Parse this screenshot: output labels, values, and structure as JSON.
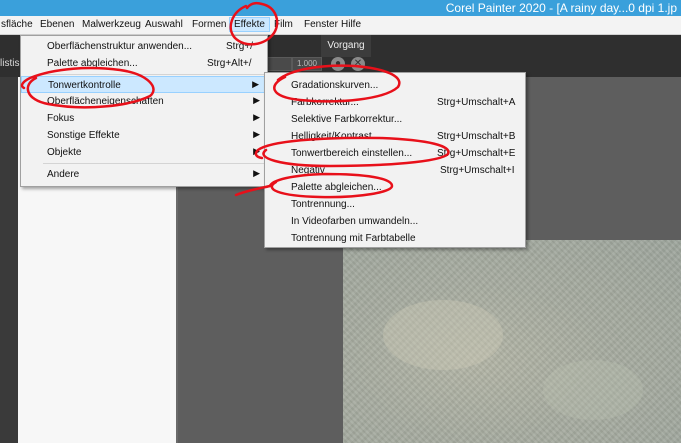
{
  "window": {
    "title": "Corel Painter 2020 - [A rainy day...0 dpi 1.jp"
  },
  "menubar": {
    "items": [
      "sfläche",
      "Ebenen",
      "Malwerkzeug",
      "Auswahl",
      "Formen",
      "Effekte",
      "Film",
      "Fenster",
      "Hilfe"
    ],
    "active": "Effekte"
  },
  "toolbar": {
    "left_label": "listis",
    "field_a": "",
    "field_b": "1.000"
  },
  "panel": {
    "header": "Vorgang"
  },
  "effects_menu": {
    "items": [
      {
        "label": "Oberflächenstruktur anwenden...",
        "shortcut": "Strg+/"
      },
      {
        "label": "Palette abgleichen...",
        "shortcut": "Strg+Alt+/"
      },
      {
        "label": "Tonwertkontrolle",
        "shortcut": ""
      },
      {
        "label": "Oberflächeneigenschaften",
        "shortcut": ""
      },
      {
        "label": "Fokus",
        "shortcut": ""
      },
      {
        "label": "Sonstige Effekte",
        "shortcut": ""
      },
      {
        "label": "Objekte",
        "shortcut": ""
      },
      {
        "label": "Andere",
        "shortcut": ""
      }
    ]
  },
  "tonwert_submenu": {
    "items": [
      {
        "label": "Gradationskurven...",
        "shortcut": ""
      },
      {
        "label": "Farbkorrektur...",
        "shortcut": "Strg+Umschalt+A"
      },
      {
        "label": "Selektive Farbkorrektur...",
        "shortcut": ""
      },
      {
        "label": "Helligkeit/Kontrast...",
        "shortcut": "Strg+Umschalt+B"
      },
      {
        "label": "Tonwertbereich einstellen...",
        "shortcut": "Strg+Umschalt+E"
      },
      {
        "label": "Negativ",
        "shortcut": "Strg+Umschalt+I"
      },
      {
        "label": "Palette abgleichen...",
        "shortcut": ""
      },
      {
        "label": "Tontrennung...",
        "shortcut": ""
      },
      {
        "label": "In Videofarben umwandeln...",
        "shortcut": ""
      },
      {
        "label": "Tontrennung mit Farbtabelle",
        "shortcut": ""
      }
    ]
  },
  "colors": {
    "titlebar": "#3aa0db",
    "highlight": "#cce8ff",
    "annotation": "#e8101a"
  }
}
